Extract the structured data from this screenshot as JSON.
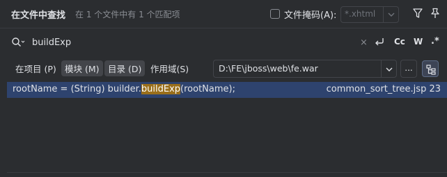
{
  "header": {
    "title": "在文件中查找",
    "match_info": "在 1 个文件中有 1 个匹配项",
    "file_mask_label": "文件掩码(A):",
    "file_mask_placeholder": "*.xhtml"
  },
  "search": {
    "query": "buildExp",
    "clear_symbol": "×",
    "match_case_label": "Cc",
    "whole_words_label": "W",
    "regex_label": ".*"
  },
  "scope": {
    "tabs": [
      {
        "label": "在项目 (P)",
        "active": false
      },
      {
        "label": "模块 (M)",
        "active": true
      },
      {
        "label": "目录 (D)",
        "active": true
      },
      {
        "label": "作用域(S)",
        "active": false
      }
    ],
    "directory": "D:\\FE\\jboss\\web\\fe.war",
    "browse_label": "..."
  },
  "results": [
    {
      "code_before": "rootName = (String) builder.",
      "code_match": "buildExp",
      "code_after": "(rootName);",
      "file": "common_sort_tree.jsp 23"
    }
  ],
  "colors": {
    "background": "#2b2d30",
    "selected_row": "#2e436e",
    "match_highlight": "#9a6f1b"
  },
  "icons": [
    "filter-icon",
    "pin-icon",
    "search-icon",
    "clear-icon",
    "newline-icon",
    "chevron-down-icon",
    "recursive-icon"
  ]
}
